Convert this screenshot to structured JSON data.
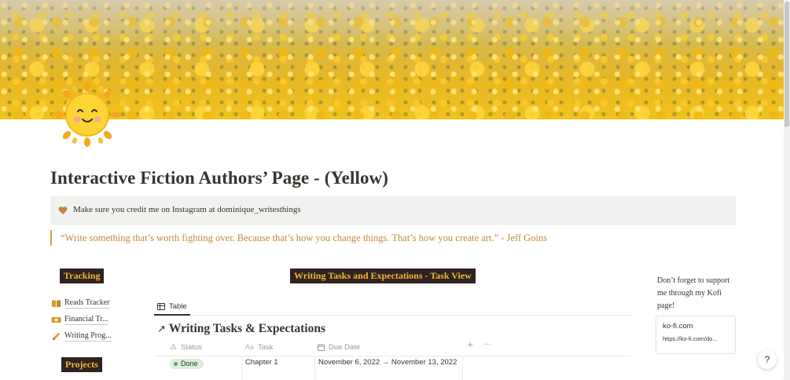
{
  "page": {
    "title": "Interactive Fiction Authors’ Page - (Yellow)",
    "icon": "smiling-sun-icon",
    "cover": "yellow-flower-field"
  },
  "callout": {
    "icon": "heart-icon",
    "text": "Make sure you credit me on Instagram at dominique_writesthings"
  },
  "quote": {
    "text": "“Write something that’s worth fighting over. Because that’s how you change things. That’s how you create art.” - Jeff Goins"
  },
  "sidebar": {
    "tracking_heading": "Tracking",
    "projects_heading": "Projects",
    "links": [
      {
        "label": "Reads Tracker",
        "icon": "open-book-icon"
      },
      {
        "label": "Financial Tr...",
        "icon": "money-icon"
      },
      {
        "label": "Writing Prog...",
        "icon": "pencil-icon"
      }
    ]
  },
  "main": {
    "heading": "Writing Tasks and Expectations - Task View",
    "view_tab": "Table",
    "database_title": "Writing Tasks & Expectations",
    "columns": [
      {
        "label": "Status",
        "icon": "status-icon"
      },
      {
        "label": "Task",
        "icon": "text-property-icon"
      },
      {
        "label": "Due Date",
        "icon": "calendar-icon"
      }
    ],
    "add_symbol": "+",
    "more_symbol": "···",
    "rows": [
      {
        "status": "Done",
        "task": "Chapter 1",
        "due_date": "November 6, 2022 → November 13, 2022"
      }
    ]
  },
  "side": {
    "note": "Don’t forget to support me through my Kofi page!",
    "bookmark_title": "ko-fi.com",
    "bookmark_url": "https://ko-fi.com/do..."
  },
  "help": {
    "label": "?"
  },
  "colors": {
    "tag_bg": "#2e2320",
    "tag_text": "#f2b632",
    "quote": "#c08a3a",
    "callout_bg": "#f1f1ef",
    "done_pill": "#dbeddb"
  }
}
